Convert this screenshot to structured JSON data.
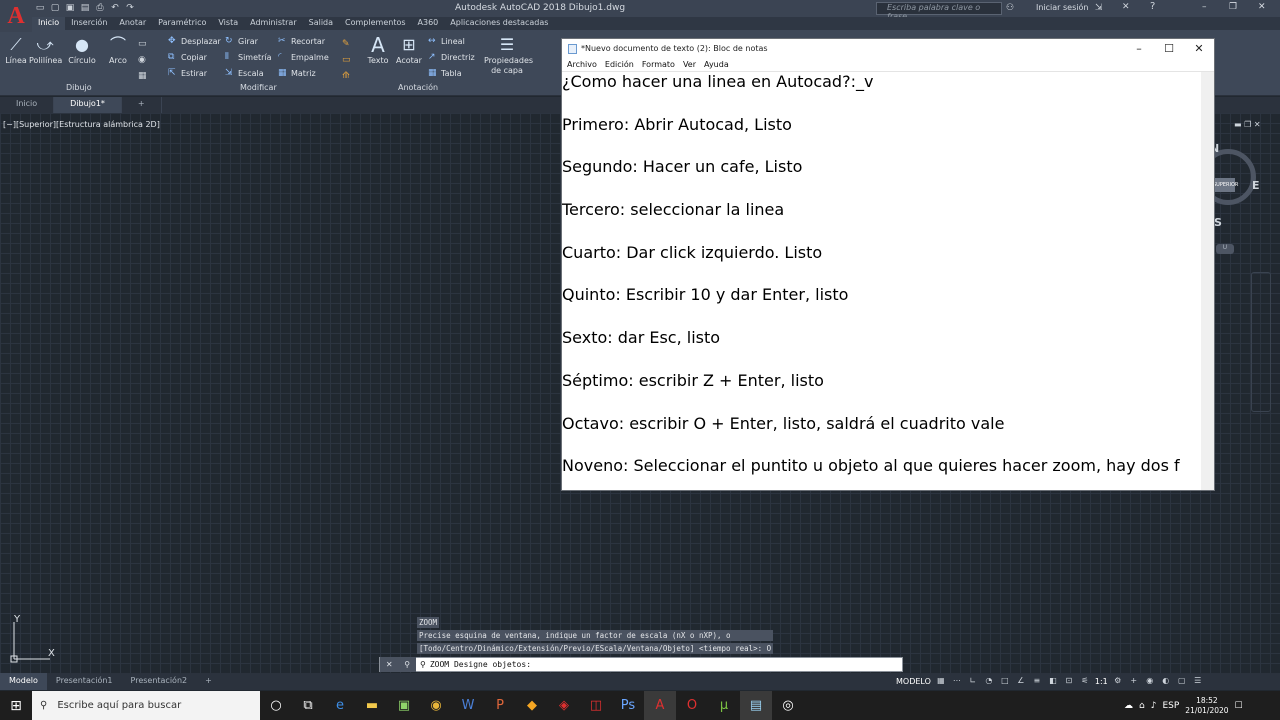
{
  "window": {
    "title": "Autodesk AutoCAD 2018   Dibujo1.dwg",
    "search_placeholder": "Escriba palabra clave o frase",
    "signin": "Iniciar sesión"
  },
  "ribbon_tabs": [
    "Inicio",
    "Inserción",
    "Anotar",
    "Paramétrico",
    "Vista",
    "Administrar",
    "Salida",
    "Complementos",
    "A360",
    "Aplicaciones destacadas"
  ],
  "ribbon": {
    "draw": {
      "linea": "Línea",
      "polilinea": "Polilínea",
      "circulo": "Círculo",
      "arco": "Arco",
      "panel": "Dibujo"
    },
    "modify": {
      "desplazar": "Desplazar",
      "girar": "Girar",
      "recortar": "Recortar",
      "copiar": "Copiar",
      "simetria": "Simetría",
      "empalme": "Empalme",
      "estirar": "Estirar",
      "escala": "Escala",
      "matriz": "Matriz",
      "panel": "Modificar"
    },
    "annotation": {
      "texto": "Texto",
      "acotar": "Acotar",
      "lineal": "Lineal",
      "directriz": "Directriz",
      "tabla": "Tabla",
      "panel": "Anotación"
    },
    "layers": {
      "propiedades": "Propiedades de capa"
    }
  },
  "doc_tabs": [
    "Inicio",
    "Dibujo1*"
  ],
  "viewport_label": "[−][Superior][Estructura alámbrica 2D]",
  "notepad": {
    "title": "*Nuevo documento de texto (2): Bloc de notas",
    "menu": [
      "Archivo",
      "Edición",
      "Formato",
      "Ver",
      "Ayuda"
    ],
    "lines": [
      "¿Como hacer una linea en Autocad?:_v",
      "Primero: Abrir Autocad, Listo",
      "Segundo: Hacer un cafe, Listo",
      "Tercero: seleccionar la linea",
      "Cuarto: Dar click izquierdo. Listo",
      "Quinto: Escribir 10 y dar Enter, listo",
      "Sexto: dar Esc, listo",
      "Séptimo: escribir Z + Enter, listo",
      "Octavo: escribir O + Enter, listo, saldrá el cuadrito vale",
      "Noveno: Seleccionar el puntito u objeto al que quieres hacer zoom, hay dos f"
    ]
  },
  "viewcube": {
    "n": "N",
    "e": "E",
    "s": "S",
    "center": "SUPERIOR",
    "wcs": "U"
  },
  "command": {
    "history": [
      "ZOOM",
      "Precise esquina de ventana, indique un factor de escala (nX o nXP), o",
      "[Todo/Centro/Dinámico/Extensión/Previo/EScala/Ventana/Objeto] <tiempo real>: O"
    ],
    "prompt": "ZOOM Designe objetos:"
  },
  "layout_tabs": [
    "Modelo",
    "Presentación1",
    "Presentación2"
  ],
  "status": {
    "mode": "MODELO",
    "scale": "1:1"
  },
  "taskbar": {
    "search_placeholder": "Escribe aquí para buscar",
    "time": "18:52",
    "date": "21/01/2020"
  },
  "ucs": {
    "x": "X",
    "y": "Y"
  }
}
